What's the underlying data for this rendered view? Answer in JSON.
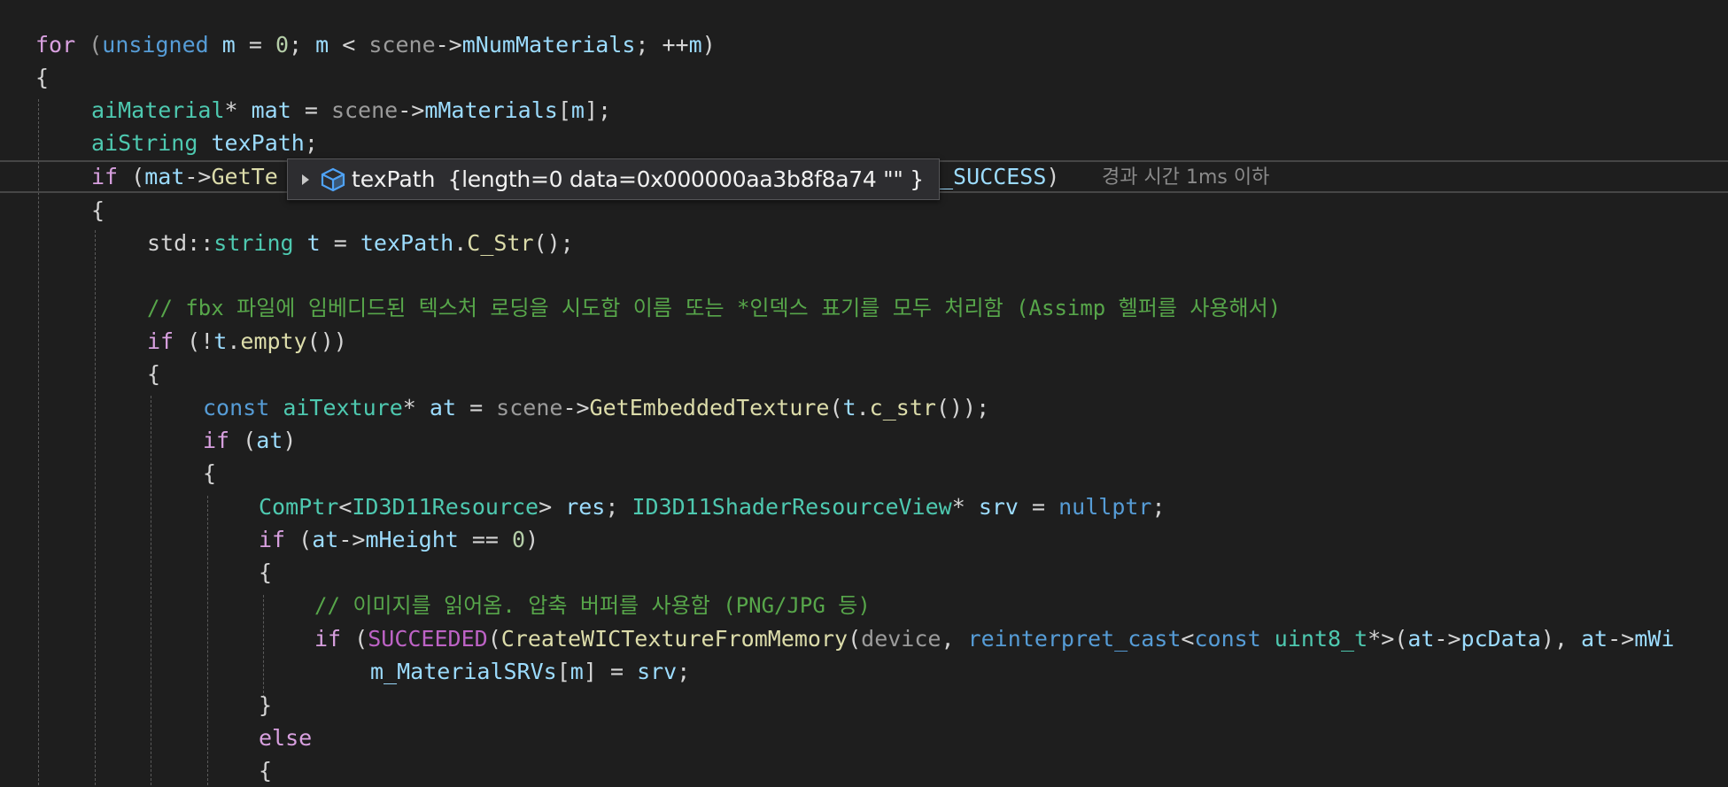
{
  "code": {
    "line1": [
      "for",
      " (",
      "unsigned",
      " ",
      "m",
      " = ",
      "0",
      "; ",
      "m",
      " < ",
      "scene",
      "->",
      "mNumMaterials",
      "; ++",
      "m",
      ")"
    ],
    "line2": [
      "{"
    ],
    "line3": [
      "aiMaterial",
      "* ",
      "mat",
      " = ",
      "scene",
      "->",
      "mMaterials",
      "[",
      "m",
      "];"
    ],
    "line4": [
      "aiString",
      " ",
      "texPath",
      ";"
    ],
    "line5_start": [
      "if",
      " (",
      "mat",
      "->",
      "GetTe"
    ],
    "line5_end": [
      "_SUCCESS",
      ")"
    ],
    "line6": [
      "{"
    ],
    "line7": [
      "std",
      "::",
      "string",
      " ",
      "t",
      " = ",
      "texPath",
      ".",
      "C_Str",
      "();"
    ],
    "line8": [
      ""
    ],
    "line9": [
      "// fbx 파일에 임베디드된 텍스처 로딩을 시도함 이름 또는 *인덱스 표기를 모두 처리함 (Assimp 헬퍼를 사용해서)"
    ],
    "line10": [
      "if",
      " (!",
      "t",
      ".",
      "empty",
      "())"
    ],
    "line11": [
      "{"
    ],
    "line12": [
      "const",
      " ",
      "aiTexture",
      "* ",
      "at",
      " = ",
      "scene",
      "->",
      "GetEmbeddedTexture",
      "(",
      "t",
      ".",
      "c_str",
      "());"
    ],
    "line13": [
      "if",
      " (",
      "at",
      ")"
    ],
    "line14": [
      "{"
    ],
    "line15": [
      "ComPtr",
      "<",
      "ID3D11Resource",
      "> ",
      "res",
      "; ",
      "ID3D11ShaderResourceView",
      "* ",
      "srv",
      " = ",
      "nullptr",
      ";"
    ],
    "line16": [
      "if",
      " (",
      "at",
      "->",
      "mHeight",
      " == ",
      "0",
      ")"
    ],
    "line17": [
      "{"
    ],
    "line18": [
      "// 이미지를 읽어옴. 압축 버퍼를 사용함 (PNG/JPG 등)"
    ],
    "line19": [
      "if",
      " (",
      "SUCCEEDED",
      "(",
      "CreateWICTextureFromMemory",
      "(",
      "device",
      ", ",
      "reinterpret_cast",
      "<",
      "const",
      " ",
      "uint8_t",
      "*>(",
      "at",
      "->",
      "pcData",
      "), ",
      "at",
      "->",
      "mWi"
    ],
    "line20": [
      "m_MaterialSRVs",
      "[",
      "m",
      "] = ",
      "srv",
      ";"
    ],
    "line21": [
      "}"
    ],
    "line22": [
      "else"
    ],
    "line23": [
      "{"
    ]
  },
  "datatip": {
    "icon": "field-cube-icon",
    "name": "texPath",
    "value": "{length=0 data=0x000000aa3b8f8a74 \"\" }"
  },
  "perf_tip": "경과 시간 1ms 이하",
  "colors": {
    "background": "#1e1e1e",
    "keyword": "#569cd6",
    "control": "#d8a0df",
    "type": "#4ec9b0",
    "function": "#dcdcaa",
    "variable": "#9cdcfe",
    "comment": "#57a64a"
  }
}
